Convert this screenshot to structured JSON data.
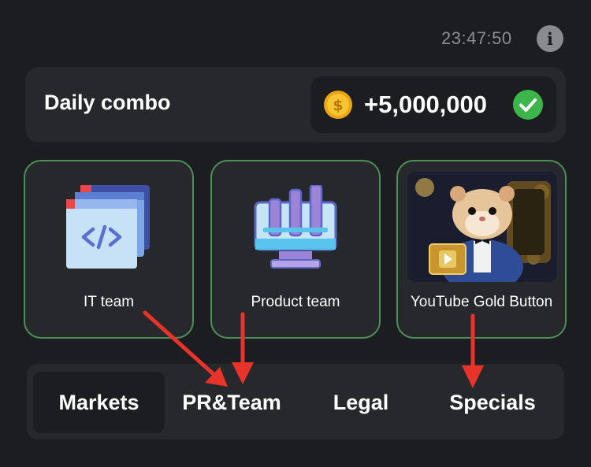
{
  "header": {
    "timer": "23:47:50",
    "info_icon": "info-icon"
  },
  "daily_combo": {
    "title": "Daily combo",
    "reward": "+5,000,000",
    "coin_icon": "gold-coin-icon",
    "status_icon": "check-circle-icon"
  },
  "cards": [
    {
      "label": "IT team",
      "icon": "code-windows-icon"
    },
    {
      "label": "Product team",
      "icon": "monitor-chart-icon"
    },
    {
      "label": "YouTube Gold Button",
      "icon": "hamster-gold-button-image"
    }
  ],
  "tabs": [
    {
      "label": "Markets",
      "active": true
    },
    {
      "label": "PR&Team",
      "active": false
    },
    {
      "label": "Legal",
      "active": false
    },
    {
      "label": "Specials",
      "active": false
    }
  ],
  "colors": {
    "background": "#1c1d20",
    "panel": "#27282c",
    "card_border": "#4d8f58",
    "annotation_arrow": "#e8332a"
  }
}
